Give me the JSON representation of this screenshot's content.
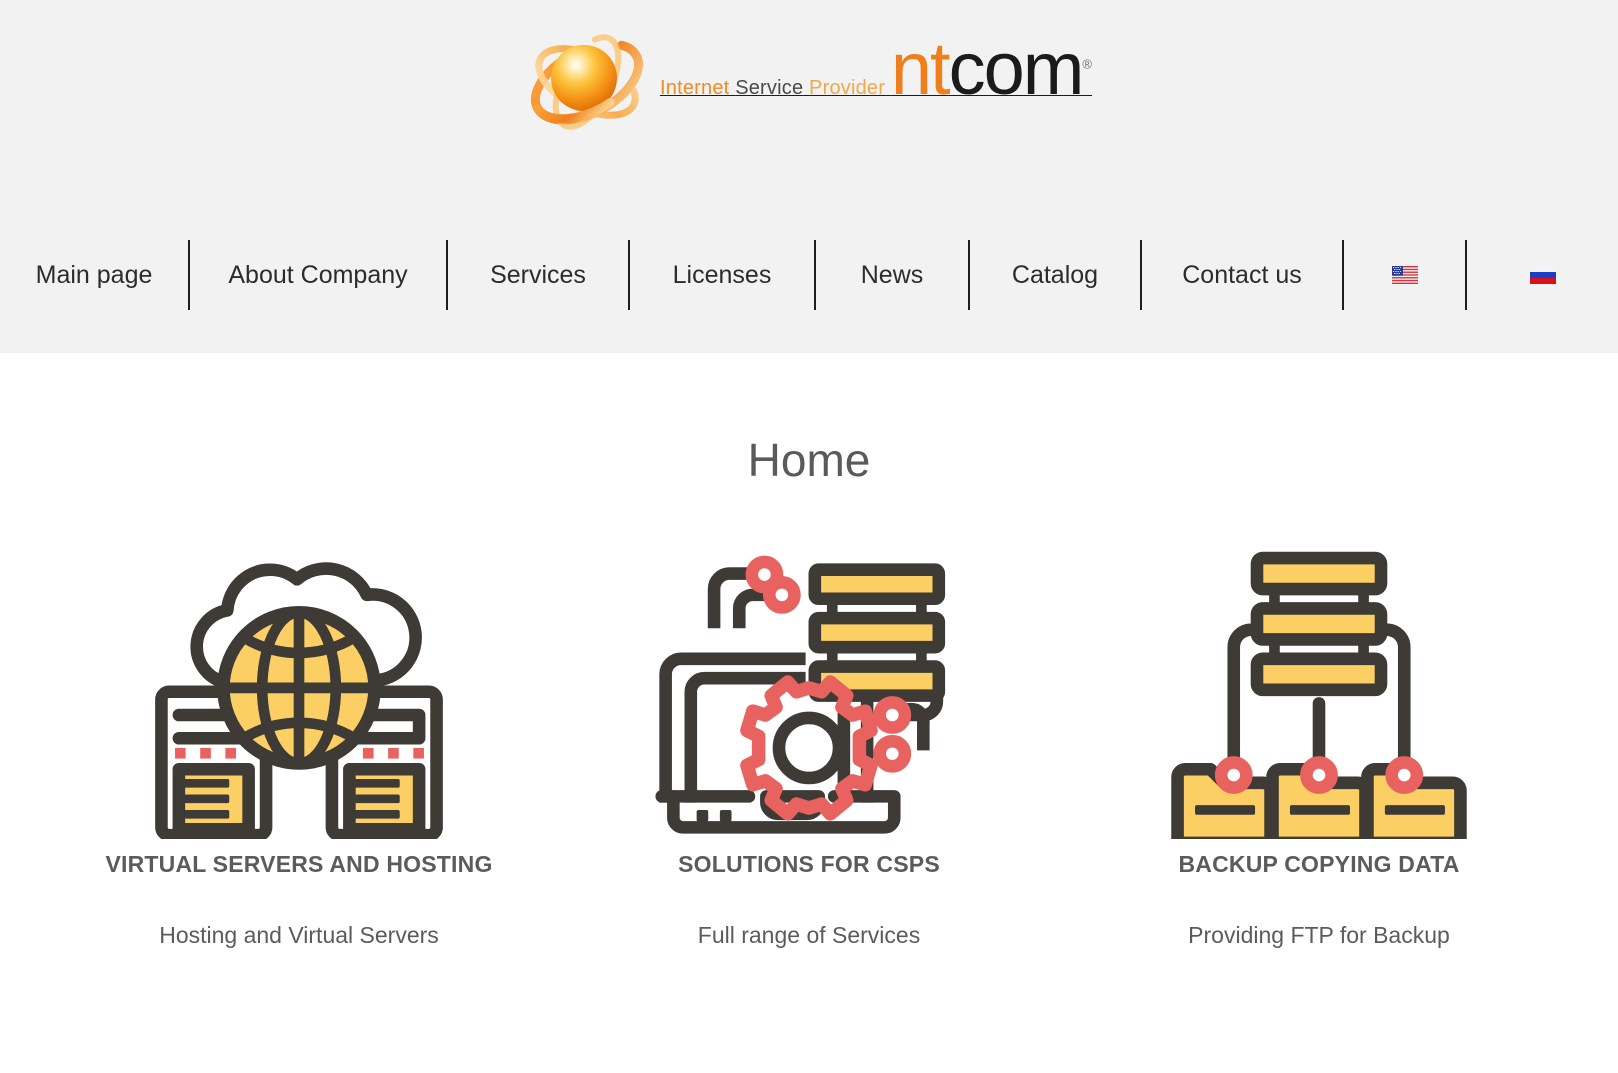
{
  "header": {
    "logo": {
      "tagline_word1": "Internet",
      "tagline_word2": "Service",
      "tagline_word3": "Provider",
      "brand_part1": "nt",
      "brand_part2": "com",
      "registered_mark": "®",
      "mark_icon": "orbit-sphere-icon"
    },
    "nav": [
      {
        "label": "Main page",
        "name": "nav-item-main-page"
      },
      {
        "label": "About Company",
        "name": "nav-item-about-company"
      },
      {
        "label": "Services",
        "name": "nav-item-services"
      },
      {
        "label": "Licenses",
        "name": "nav-item-licenses"
      },
      {
        "label": "News",
        "name": "nav-item-news"
      },
      {
        "label": "Catalog",
        "name": "nav-item-catalog"
      },
      {
        "label": "Contact us",
        "name": "nav-item-contact-us"
      }
    ],
    "languages": [
      {
        "icon": "flag-usa-icon",
        "label": "English"
      },
      {
        "icon": "flag-russia-icon",
        "label": "Russian"
      }
    ]
  },
  "main": {
    "page_title": "Home",
    "cards": [
      {
        "icon": "cloud-globe-servers-icon",
        "title": "VIRTUAL SERVERS AND HOSTING",
        "description": "Hosting and Virtual Servers"
      },
      {
        "icon": "laptop-gear-server-icon",
        "title": "SOLUTIONS FOR CSPS",
        "description": "Full range of Services"
      },
      {
        "icon": "server-folders-network-icon",
        "title": "BACKUP COPYING DATA",
        "description": "Providing FTP for Backup"
      }
    ]
  },
  "colors": {
    "header_bg": "#f2f2f2",
    "page_bg": "#ffffff",
    "text": "#5b5b5b",
    "nav_text": "#2c2c2c",
    "brand_orange": "#ef7f1a",
    "brand_dark": "#1b1b1b",
    "icon_dark": "#3e3a35",
    "icon_yellow": "#fbcf63",
    "icon_red": "#e8635f"
  }
}
